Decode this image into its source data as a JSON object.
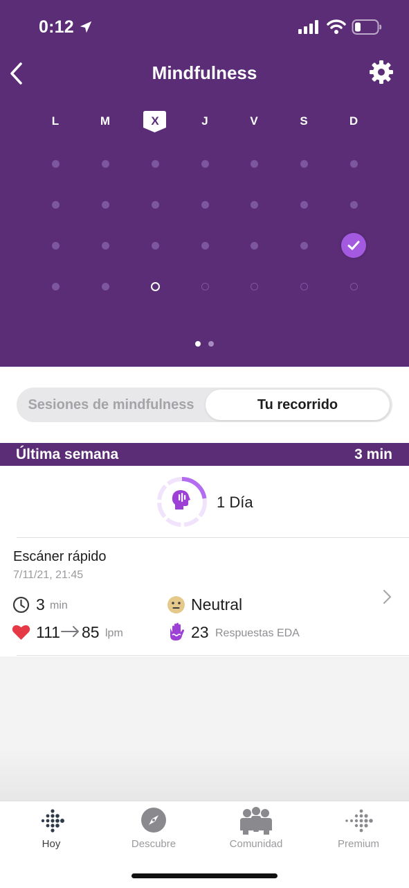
{
  "colors": {
    "header_bg": "#5b2d77",
    "accent_purple": "#a35ae0",
    "dot_inactive": "#7d56a0",
    "heart_red": "#e63946",
    "emoji_face": "#e5c98b"
  },
  "status_bar": {
    "time": "0:12",
    "icons": [
      "location-arrow-icon",
      "cellular-signal-icon",
      "wifi-icon",
      "battery-icon"
    ]
  },
  "nav": {
    "title": "Mindfulness",
    "back_icon": "chevron-left-icon",
    "settings_icon": "gear-icon"
  },
  "calendar": {
    "days": [
      "L",
      "M",
      "X",
      "J",
      "V",
      "S",
      "D"
    ],
    "current_day": "X",
    "weeks": 4,
    "completed": [
      {
        "week": 3,
        "day": "D"
      }
    ],
    "today": {
      "week": 4,
      "day": "X"
    },
    "pages": 2,
    "active_page": 1
  },
  "segments": {
    "left_label": "Sesiones de mindfulness",
    "right_label": "Tu recorrido",
    "selected": "Tu recorrido"
  },
  "week_summary": {
    "label": "Última semana",
    "total": "3 min"
  },
  "streak": {
    "label": "1 Día",
    "icon": "mindful-head-icon"
  },
  "session": {
    "title": "Escáner rápido",
    "date": "7/11/21, 21:45",
    "duration_value": "3",
    "duration_unit": "min",
    "mood": "Neutral",
    "hr_start": "111",
    "hr_end": "85",
    "hr_unit": "lpm",
    "eda_value": "23",
    "eda_label": "Respuestas EDA"
  },
  "tabs": [
    {
      "label": "Hoy",
      "icon": "fitbit-dots-icon",
      "active": true
    },
    {
      "label": "Descubre",
      "icon": "compass-icon",
      "active": false
    },
    {
      "label": "Comunidad",
      "icon": "community-people-icon",
      "active": false
    },
    {
      "label": "Premium",
      "icon": "premium-dots-icon",
      "active": false
    }
  ]
}
